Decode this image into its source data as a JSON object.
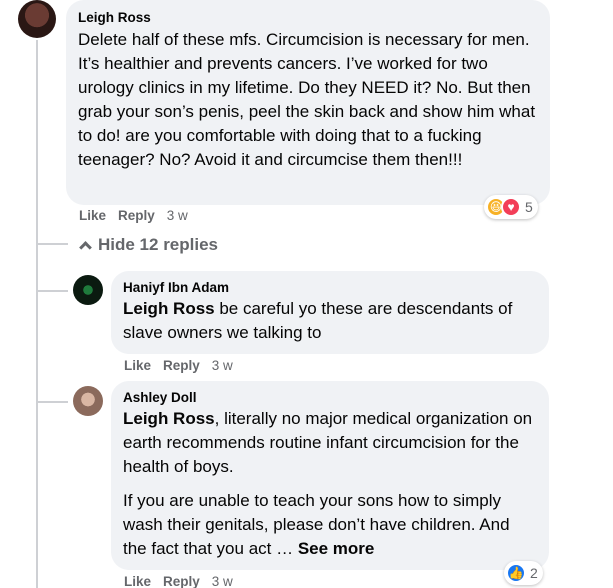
{
  "comment": {
    "author": "Leigh Ross",
    "text": "Delete half of these mfs. Circumcision is necessary for men. It’s healthier and prevents cancers. I’ve worked for two urology clinics in my lifetime. Do they NEED it? No. But then grab your son’s penis, peel the skin back and show him what to do! are you comfortable with doing that to a fucking teenager? No? Avoid it and circumcise them then!!!",
    "like_label": "Like",
    "reply_label": "Reply",
    "time": "3 w",
    "reaction_count": "5"
  },
  "hide_replies_label": "Hide 12 replies",
  "replies": [
    {
      "author": "Haniyf Ibn Adam",
      "mention": "Leigh Ross",
      "text": " be careful yo these are descendants of slave owners we talking to",
      "like_label": "Like",
      "reply_label": "Reply",
      "time": "3 w"
    },
    {
      "author": "Ashley Doll",
      "mention": "Leigh Ross",
      "text": ", literally no major medical organization on earth recommends routine infant circumcision for the health of boys.",
      "text2": "If you are unable to teach your sons how to simply wash their genitals, please don’t have children. And the fact that you act …",
      "see_more": "See more",
      "like_label": "Like",
      "reply_label": "Reply",
      "time": "3 w",
      "reaction_count": "2"
    }
  ],
  "colors": {
    "bubble_bg": "#f0f2f5",
    "meta_text": "#65676b",
    "like_blue": "#1877f2",
    "love_red": "#f33e58",
    "haha_yellow": "#f7b125"
  }
}
